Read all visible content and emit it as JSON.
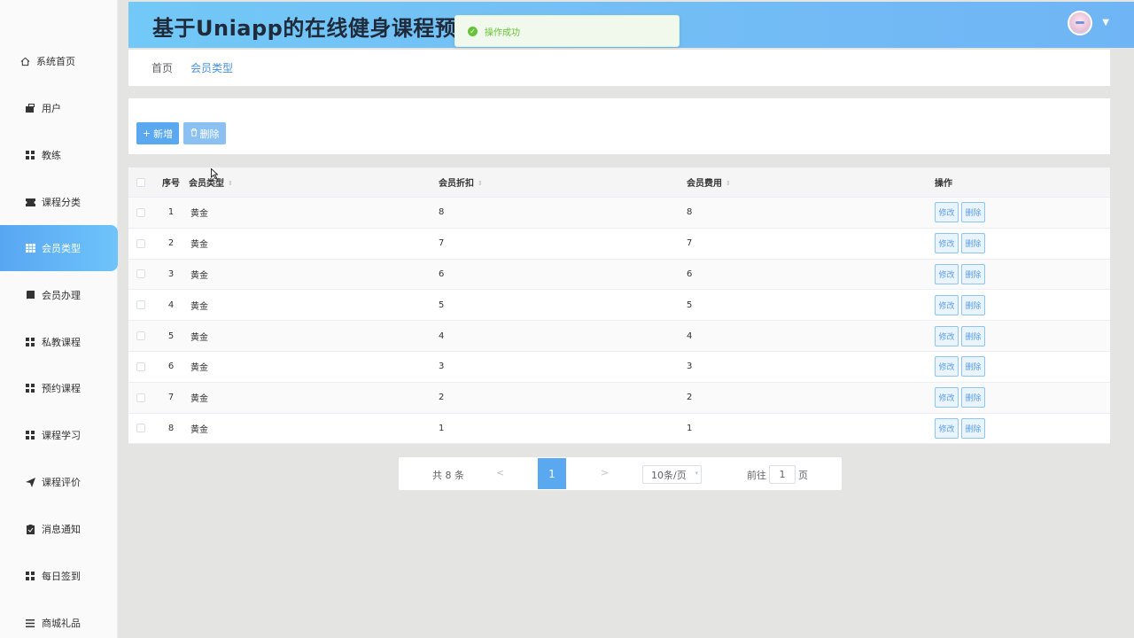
{
  "header": {
    "title": "基于Uniapp的在线健身课程预约",
    "toast": "操作成功"
  },
  "sidebar": {
    "items": [
      {
        "label": "系统首页",
        "icon": "home-icon"
      },
      {
        "label": "用户",
        "icon": "user-icon"
      },
      {
        "label": "教练",
        "icon": "grid-icon"
      },
      {
        "label": "课程分类",
        "icon": "ticket-icon"
      },
      {
        "label": "会员类型",
        "icon": "table-icon",
        "active": true
      },
      {
        "label": "会员办理",
        "icon": "card-icon"
      },
      {
        "label": "私教课程",
        "icon": "grid-icon"
      },
      {
        "label": "预约课程",
        "icon": "grid-icon"
      },
      {
        "label": "课程学习",
        "icon": "grid-icon"
      },
      {
        "label": "课程评价",
        "icon": "send-icon"
      },
      {
        "label": "消息通知",
        "icon": "clipboard-icon"
      },
      {
        "label": "每日签到",
        "icon": "grid-icon"
      },
      {
        "label": "商城礼品",
        "icon": "list-icon"
      }
    ]
  },
  "breadcrumb": {
    "home": "首页",
    "current": "会员类型"
  },
  "toolbar": {
    "add_label": "新增",
    "delete_label": "删除"
  },
  "table": {
    "headers": {
      "index": "序号",
      "type": "会员类型",
      "discount": "会员折扣",
      "fee": "会员费用",
      "ops": "操作"
    },
    "rows": [
      {
        "index": "1",
        "type": "黄金",
        "discount": "8",
        "fee": "8"
      },
      {
        "index": "2",
        "type": "黄金",
        "discount": "7",
        "fee": "7"
      },
      {
        "index": "3",
        "type": "黄金",
        "discount": "6",
        "fee": "6"
      },
      {
        "index": "4",
        "type": "黄金",
        "discount": "5",
        "fee": "5"
      },
      {
        "index": "5",
        "type": "黄金",
        "discount": "4",
        "fee": "4"
      },
      {
        "index": "6",
        "type": "黄金",
        "discount": "3",
        "fee": "3"
      },
      {
        "index": "7",
        "type": "黄金",
        "discount": "2",
        "fee": "2"
      },
      {
        "index": "8",
        "type": "黄金",
        "discount": "1",
        "fee": "1"
      }
    ],
    "edit_label": "修改",
    "delete_label": "删除"
  },
  "pagination": {
    "total": "共 8 条",
    "current_page": "1",
    "page_size": "10条/页",
    "goto_prefix": "前往",
    "goto_value": "1",
    "goto_suffix": "页"
  },
  "colors": {
    "accent": "#5aa8f0",
    "success": "#67c23a"
  }
}
